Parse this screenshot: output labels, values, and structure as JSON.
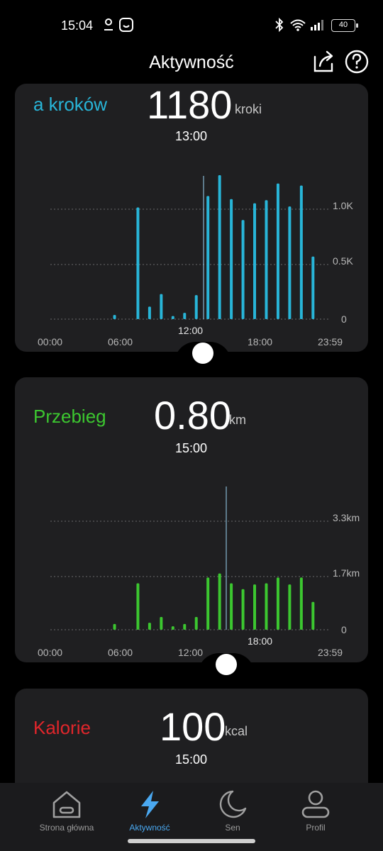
{
  "status_bar": {
    "time": "15:04",
    "battery": "40"
  },
  "header": {
    "title": "Aktywność"
  },
  "steps_card": {
    "label": "a kroków",
    "label_color": "#28b5d8",
    "value": "1180",
    "unit": "kroki",
    "time": "13:00",
    "y_ticks": [
      "1.0K",
      "0.5K",
      "0"
    ],
    "x_ticks": [
      "00:00",
      "06:00",
      "18:00",
      "23:59"
    ],
    "cursor_label": "12:00",
    "bar_color": "#28b5d8"
  },
  "distance_card": {
    "label": "Przebieg",
    "label_color": "#3cc730",
    "value": "0.80",
    "unit": "km",
    "time": "15:00",
    "y_ticks": [
      "3.3km",
      "1.7km",
      "0"
    ],
    "x_ticks": [
      "00:00",
      "06:00",
      "12:00",
      "23:59"
    ],
    "cursor_label": "18:00",
    "bar_color": "#3cc730"
  },
  "calories_card": {
    "label": "Kalorie",
    "label_color": "#e0262b",
    "value": "100",
    "unit": "kcal",
    "time": "15:00"
  },
  "nav": {
    "items": [
      {
        "label": "Strona główna"
      },
      {
        "label": "Aktywność"
      },
      {
        "label": "Sen"
      },
      {
        "label": "Profil"
      }
    ],
    "active_color": "#4aa8f0"
  },
  "chart_data": [
    {
      "type": "bar",
      "x": [
        "05:00",
        "07:00",
        "08:00",
        "09:00",
        "10:00",
        "11:00",
        "12:00",
        "13:00",
        "14:00",
        "15:00",
        "16:00",
        "17:00",
        "18:00",
        "19:00",
        "20:00",
        "21:00",
        "22:00"
      ],
      "values": [
        40,
        1070,
        120,
        240,
        30,
        60,
        230,
        1180,
        1380,
        1150,
        950,
        1110,
        1140,
        1300,
        1080,
        1280,
        600
      ],
      "y_ticks": [
        "0",
        "0.5K",
        "1.0K"
      ],
      "x_ticks": [
        "00:00",
        "06:00",
        "12:00",
        "18:00",
        "23:59"
      ],
      "grid": true
    },
    {
      "type": "bar",
      "x": [
        "05:00",
        "07:00",
        "08:00",
        "09:00",
        "10:00",
        "11:00",
        "12:00",
        "13:00",
        "14:00",
        "15:00",
        "16:00",
        "17:00",
        "18:00",
        "19:00",
        "20:00",
        "21:00",
        "22:00"
      ],
      "values": [
        0.1,
        0.8,
        0.12,
        0.22,
        0.06,
        0.1,
        0.22,
        0.9,
        0.97,
        0.8,
        0.7,
        0.78,
        0.8,
        0.9,
        0.78,
        0.9,
        0.48
      ],
      "y_ticks": [
        "0",
        "1.7km",
        "3.3km"
      ],
      "x_ticks": [
        "00:00",
        "06:00",
        "12:00",
        "18:00",
        "23:59"
      ],
      "grid": true
    }
  ]
}
